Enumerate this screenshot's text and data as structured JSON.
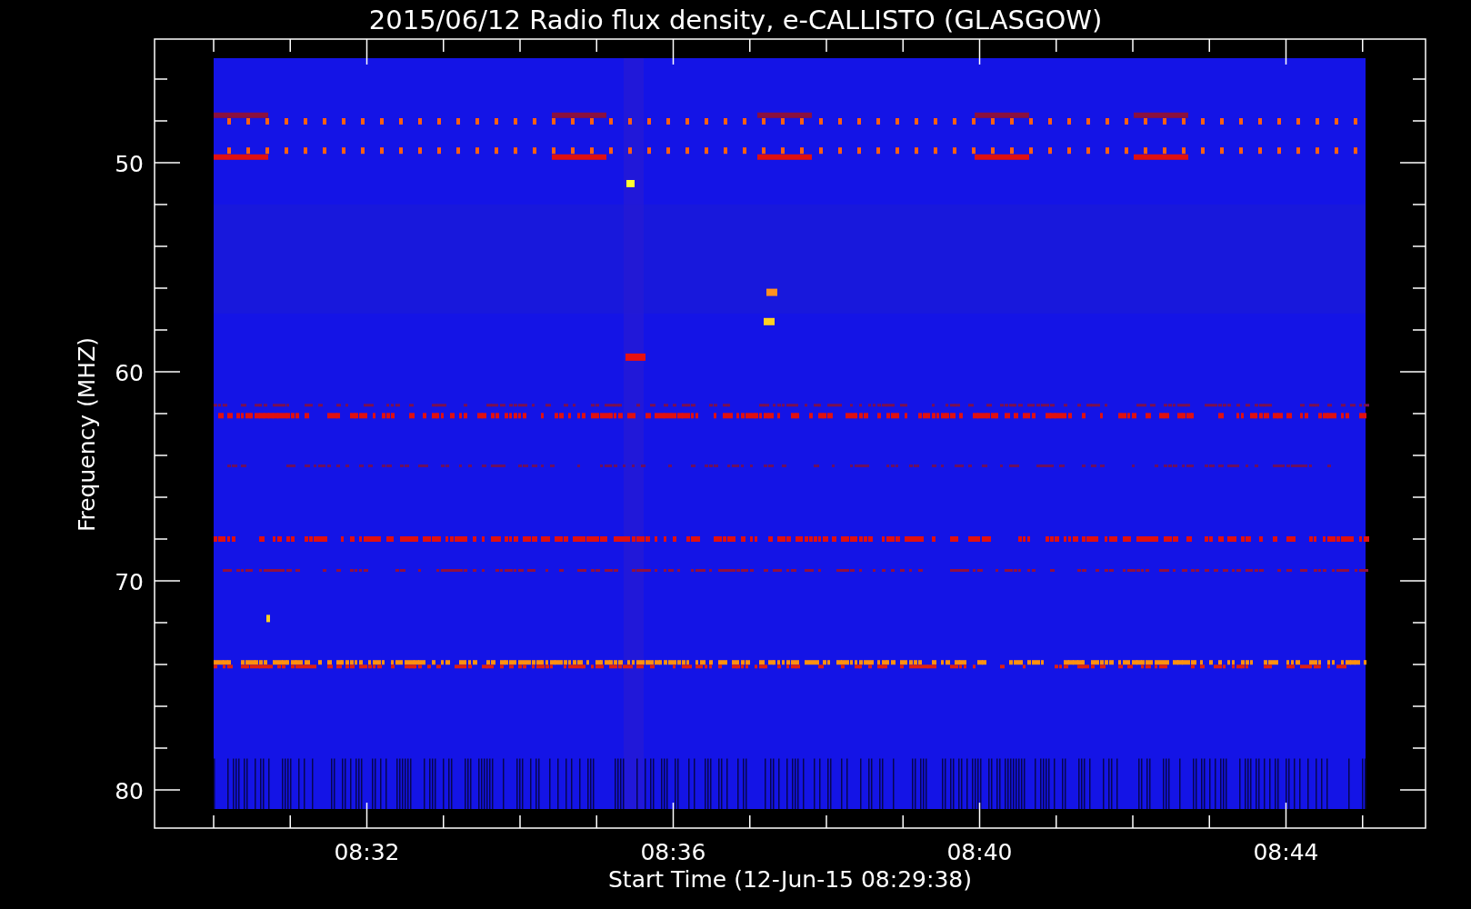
{
  "title": "2015/06/12  Radio flux density, e-CALLISTO (GLASGOW)",
  "y_axis": {
    "label": "Frequency (MHZ)",
    "ticks": [
      "50",
      "60",
      "70",
      "80"
    ]
  },
  "x_axis": {
    "label": "Start Time (12-Jun-15 08:29:38)",
    "ticks": [
      "08:32",
      "08:36",
      "08:40",
      "08:44"
    ]
  }
}
